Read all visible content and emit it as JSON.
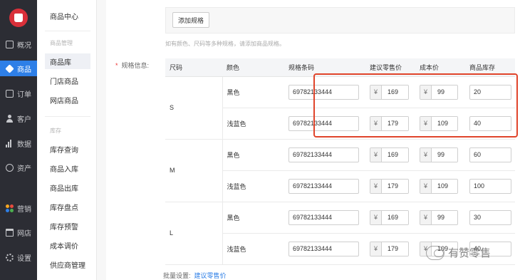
{
  "nav_main": [
    {
      "label": "概况",
      "icon": "monitor-icon"
    },
    {
      "label": "商品",
      "icon": "tag-icon",
      "active": true
    },
    {
      "label": "订单",
      "icon": "order-icon"
    },
    {
      "label": "客户",
      "icon": "user-icon"
    },
    {
      "label": "数据",
      "icon": "bar-chart-icon"
    },
    {
      "label": "资产",
      "icon": "yen-icon"
    },
    {
      "label": "营销",
      "icon": "apps-icon"
    },
    {
      "label": "网店",
      "icon": "shop-icon"
    },
    {
      "label": "设置",
      "icon": "gear-icon"
    }
  ],
  "nav_sub": {
    "top": "商品中心",
    "group1": "商品管理",
    "items1": [
      "商品库",
      "门店商品",
      "网店商品"
    ],
    "group2": "库存",
    "items2": [
      "库存查询",
      "商品入库",
      "商品出库",
      "库存盘点",
      "库存预警",
      "成本调价",
      "供应商管理"
    ]
  },
  "spec": {
    "add_button": "添加规格",
    "hint": "如有颜色、尺码等多种规格，请添加商品规格。",
    "label_required": "*",
    "label": "规格信息:",
    "currency": "¥",
    "headers": [
      "尺码",
      "颜色",
      "规格条码",
      "建议零售价",
      "成本价",
      "商品库存"
    ],
    "groups": [
      {
        "size": "S",
        "rows": [
          {
            "color": "黑色",
            "barcode": "69782133444",
            "retail": "169",
            "cost": "99",
            "stock": "20"
          },
          {
            "color": "浅蓝色",
            "barcode": "69782133444",
            "retail": "179",
            "cost": "109",
            "stock": "40"
          }
        ]
      },
      {
        "size": "M",
        "rows": [
          {
            "color": "黑色",
            "barcode": "69782133444",
            "retail": "169",
            "cost": "99",
            "stock": "60"
          },
          {
            "color": "浅蓝色",
            "barcode": "69782133444",
            "retail": "179",
            "cost": "109",
            "stock": "100"
          }
        ]
      },
      {
        "size": "L",
        "rows": [
          {
            "color": "黑色",
            "barcode": "69782133444",
            "retail": "169",
            "cost": "99",
            "stock": "30"
          },
          {
            "color": "浅蓝色",
            "barcode": "69782133444",
            "retail": "179",
            "cost": "109",
            "stock": "40"
          }
        ]
      }
    ],
    "bulk_label": "批量设置:",
    "bulk_link": "建议零售价"
  },
  "watermark": "有赞零售",
  "colors": {
    "active_nav": "#2e7fe7",
    "highlight": "#e0442b",
    "sidebar": "#2c2d34"
  }
}
